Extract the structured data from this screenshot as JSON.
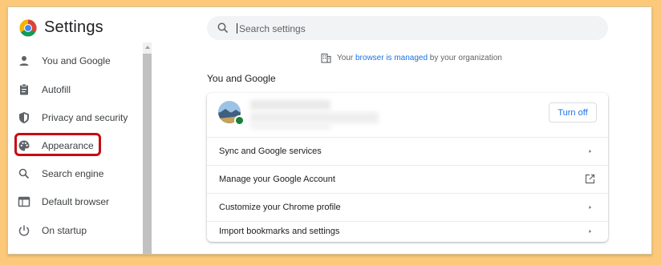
{
  "app": {
    "title": "Settings"
  },
  "search": {
    "placeholder": "Search settings"
  },
  "sidebar": {
    "items": [
      {
        "label": "You and Google",
        "icon": "person-icon"
      },
      {
        "label": "Autofill",
        "icon": "clipboard-icon"
      },
      {
        "label": "Privacy and security",
        "icon": "shield-icon"
      },
      {
        "label": "Appearance",
        "icon": "palette-icon",
        "highlighted": true
      },
      {
        "label": "Search engine",
        "icon": "search-icon"
      },
      {
        "label": "Default browser",
        "icon": "browser-window-icon"
      },
      {
        "label": "On startup",
        "icon": "power-icon"
      }
    ]
  },
  "managed_notice": {
    "prefix": "Your ",
    "link": "browser is managed",
    "suffix": " by your organization"
  },
  "section": {
    "title": "You and Google"
  },
  "card": {
    "turn_off_label": "Turn off",
    "rows": [
      {
        "label": "Sync and Google services",
        "action": "chevron-right-icon"
      },
      {
        "label": "Manage your Google Account",
        "action": "open-in-new-icon"
      },
      {
        "label": "Customize your Chrome profile",
        "action": "chevron-right-icon"
      },
      {
        "label": "Import bookmarks and settings",
        "action": "chevron-right-icon"
      }
    ]
  },
  "colors": {
    "background": "#fcc97a",
    "accent": "#1a73e8",
    "highlight_border": "#c60c13",
    "sync_badge": "#188038"
  }
}
